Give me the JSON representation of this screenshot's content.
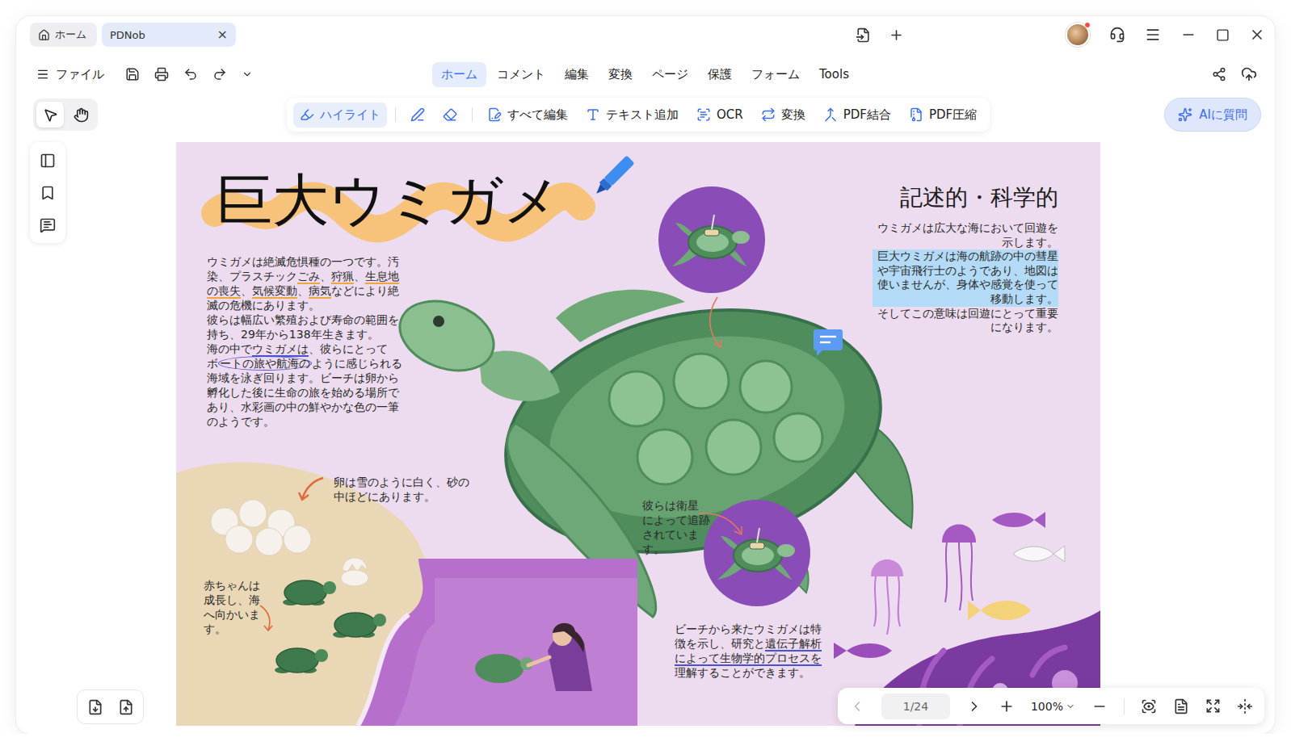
{
  "window": {
    "tabs": [
      {
        "label": "ホーム",
        "kind": "home",
        "selected": false
      },
      {
        "label": "PDNob",
        "kind": "doc",
        "selected": true,
        "close": "×"
      }
    ]
  },
  "avatar": {
    "notification": true
  },
  "menu": {
    "file": "ファイル",
    "tabs": [
      {
        "label": "ホーム",
        "selected": true
      },
      {
        "label": "コメント",
        "selected": false
      },
      {
        "label": "編集",
        "selected": false
      },
      {
        "label": "変換",
        "selected": false
      },
      {
        "label": "ページ",
        "selected": false
      },
      {
        "label": "保護",
        "selected": false
      },
      {
        "label": "フォーム",
        "selected": false
      },
      {
        "label": "Tools",
        "selected": false
      }
    ]
  },
  "tools": [
    {
      "kind": "select",
      "selected": true
    },
    {
      "kind": "hand",
      "selected": false
    }
  ],
  "toolbar": {
    "items": [
      {
        "kind": "highlight",
        "label": "ハイライト",
        "selected": true,
        "group": 1
      },
      {
        "kind": "pen",
        "selected": false,
        "group": 2
      },
      {
        "kind": "eraser",
        "selected": false,
        "group": 2
      },
      {
        "kind": "edit",
        "label": "すべて編集",
        "selected": false,
        "group": 3
      },
      {
        "kind": "text",
        "label": "テキスト追加",
        "selected": false,
        "group": 3
      },
      {
        "kind": "ocr",
        "label": "OCR",
        "selected": false,
        "group": 3
      },
      {
        "kind": "convert",
        "label": "変換",
        "selected": false,
        "group": 3
      },
      {
        "kind": "merge",
        "label": "PDF結合",
        "selected": false,
        "group": 3
      },
      {
        "kind": "compress",
        "label": "PDF圧縮",
        "selected": false,
        "group": 3
      }
    ]
  },
  "ai_button": {
    "label": "AIに質問"
  },
  "document": {
    "title": "巨大ウミガメ",
    "intro": [
      [
        {
          "text": "ウミガメは絶滅危惧種の一つです。汚",
          "mark": "none"
        }
      ],
      [
        {
          "text": "染、プラスチック",
          "mark": "none"
        },
        {
          "text": "ごみ",
          "mark": "underline",
          "color": "#f0a43c"
        },
        {
          "text": "、",
          "mark": "none"
        },
        {
          "text": "狩猟",
          "mark": "underline",
          "color": "#f0a43c"
        },
        {
          "text": "、",
          "mark": "none"
        },
        {
          "text": "生息地",
          "mark": "underline",
          "color": "#f0a43c"
        }
      ],
      [
        {
          "text": "の喪失",
          "mark": "underline",
          "color": "#f0a43c"
        },
        {
          "text": "、",
          "mark": "none"
        },
        {
          "text": "気候変動",
          "mark": "underline",
          "color": "#f0a43c"
        },
        {
          "text": "、",
          "mark": "none"
        },
        {
          "text": "病気",
          "mark": "underline",
          "color": "#f0a43c"
        },
        {
          "text": "などにより絶",
          "mark": "none"
        }
      ],
      [
        {
          "text": "滅の危機にあります。",
          "mark": "none"
        }
      ],
      [
        {
          "text": "彼らは幅広い繁殖および寿命の範囲を",
          "mark": "none"
        }
      ],
      [
        {
          "text": "持ち、29年から138年生きます。",
          "mark": "none"
        }
      ],
      [
        {
          "text": "海の中で",
          "mark": "none"
        },
        {
          "text": "ウミガメは",
          "mark": "underline",
          "color": "#4b4fd6"
        },
        {
          "text": "、彼らにとって",
          "mark": "none"
        }
      ],
      [
        {
          "text": "ボ",
          "mark": "none"
        },
        {
          "text": "ートの旅や航海の",
          "mark": "circle",
          "color": "#4b4fd6"
        },
        {
          "text": "ように感じられる",
          "mark": "none"
        }
      ],
      [
        {
          "text": "海域を泳ぎ回ります。ビーチは卵から",
          "mark": "none"
        }
      ],
      [
        {
          "text": "孵化した後に生命の旅を始める場所で",
          "mark": "none"
        }
      ],
      [
        {
          "text": "あり、水彩画の中の鮮やかな色の一筆",
          "mark": "none"
        }
      ],
      [
        {
          "text": "のようです。",
          "mark": "none"
        }
      ]
    ],
    "side": {
      "heading": "記述的・科学的",
      "lines": [
        {
          "text": "ウミガメは広大な海において回遊を",
          "highlight": false
        },
        {
          "text": "示します。",
          "highlight": false
        },
        {
          "text": "巨大ウミガメは海の航跡の中の彗星",
          "highlight": true
        },
        {
          "text": "や宇宙飛行士のようであり、地図は",
          "highlight": true
        },
        {
          "text": "使いませんが、身体や感覚を使って",
          "highlight": true
        },
        {
          "text": "移動します。",
          "highlight": true
        },
        {
          "text": "そしてこの意味は回遊にとって重要",
          "highlight": false
        },
        {
          "text": "になります。",
          "highlight": false
        }
      ]
    },
    "egg_caption": [
      "卵は雪のように白く、砂の",
      "中ほどにあります。"
    ],
    "satellite_caption": [
      "彼らは衛星",
      "によって追跡",
      "されていま",
      "す。"
    ],
    "baby_caption": [
      "赤ちゃんは",
      "成長し、海",
      "へ向かいま",
      "す。"
    ],
    "research_caption": [
      [
        {
          "text": "ビーチから来たウミガメは特",
          "mark": "none"
        }
      ],
      [
        {
          "text": "徴を示し、研究と",
          "mark": "none"
        },
        {
          "text": "遺伝子解析",
          "mark": "underline",
          "color": "#4b4fd6"
        }
      ],
      [
        {
          "text": "によって生物学的プロセスを",
          "mark": "underline",
          "color": "#4b4fd6"
        }
      ],
      [
        {
          "text": "理解することができます。",
          "mark": "none"
        }
      ]
    ]
  },
  "page_nav": {
    "page": "1/24",
    "zoom": "100%",
    "prev_disabled": true
  }
}
